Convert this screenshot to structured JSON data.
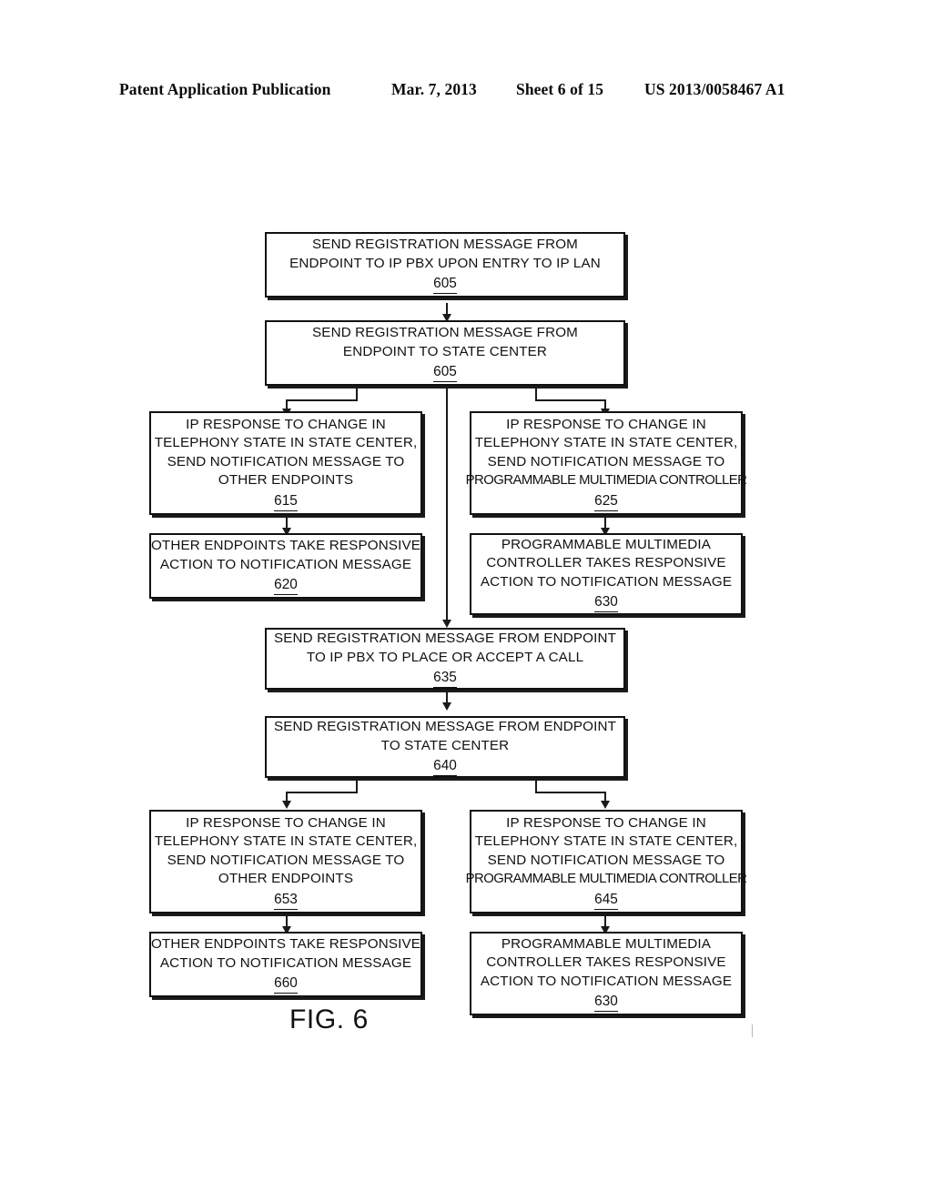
{
  "header": {
    "publication": "Patent Application Publication",
    "date": "Mar. 7, 2013",
    "sheet": "Sheet 6 of 15",
    "number": "US 2013/0058467 A1"
  },
  "figure": {
    "caption": "FIG. 6",
    "boxes": [
      {
        "id": "box-605-a",
        "lines": [
          "SEND REGISTRATION MESSAGE FROM",
          "ENDPOINT TO IP PBX UPON ENTRY TO IP LAN"
        ],
        "ref": "605"
      },
      {
        "id": "box-605-b",
        "lines": [
          "SEND REGISTRATION MESSAGE FROM",
          "ENDPOINT TO STATE CENTER"
        ],
        "ref": "605"
      },
      {
        "id": "box-615",
        "lines": [
          "IP RESPONSE TO CHANGE IN",
          "TELEPHONY STATE IN STATE CENTER,",
          "SEND NOTIFICATION MESSAGE TO",
          "OTHER ENDPOINTS"
        ],
        "ref": "615"
      },
      {
        "id": "box-625",
        "lines": [
          "IP RESPONSE TO CHANGE IN",
          "TELEPHONY STATE IN STATE CENTER,",
          "SEND NOTIFICATION MESSAGE TO",
          "PROGRAMMABLE MULTIMEDIA CONTROLLER"
        ],
        "ref": "625"
      },
      {
        "id": "box-620",
        "lines": [
          "OTHER ENDPOINTS TAKE RESPONSIVE",
          "ACTION TO NOTIFICATION MESSAGE"
        ],
        "ref": "620"
      },
      {
        "id": "box-630-a",
        "lines": [
          "PROGRAMMABLE MULTIMEDIA",
          "CONTROLLER TAKES RESPONSIVE",
          "ACTION TO NOTIFICATION MESSAGE"
        ],
        "ref": "630"
      },
      {
        "id": "box-635",
        "lines": [
          "SEND REGISTRATION MESSAGE FROM ENDPOINT",
          "TO IP PBX TO PLACE OR ACCEPT A CALL"
        ],
        "ref": "635"
      },
      {
        "id": "box-640",
        "lines": [
          "SEND REGISTRATION MESSAGE FROM ENDPOINT",
          "TO STATE CENTER"
        ],
        "ref": "640"
      },
      {
        "id": "box-653",
        "lines": [
          "IP RESPONSE TO CHANGE IN",
          "TELEPHONY STATE IN STATE CENTER,",
          "SEND NOTIFICATION MESSAGE TO",
          "OTHER ENDPOINTS"
        ],
        "ref": "653"
      },
      {
        "id": "box-645",
        "lines": [
          "IP RESPONSE TO CHANGE IN",
          "TELEPHONY STATE IN STATE CENTER,",
          "SEND NOTIFICATION MESSAGE TO",
          "PROGRAMMABLE MULTIMEDIA CONTROLLER"
        ],
        "ref": "645"
      },
      {
        "id": "box-660",
        "lines": [
          "OTHER ENDPOINTS TAKE RESPONSIVE",
          "ACTION TO NOTIFICATION MESSAGE"
        ],
        "ref": "660"
      },
      {
        "id": "box-630-b",
        "lines": [
          "PROGRAMMABLE MULTIMEDIA",
          "CONTROLLER TAKES RESPONSIVE",
          "ACTION TO NOTIFICATION MESSAGE"
        ],
        "ref": "630"
      }
    ]
  }
}
